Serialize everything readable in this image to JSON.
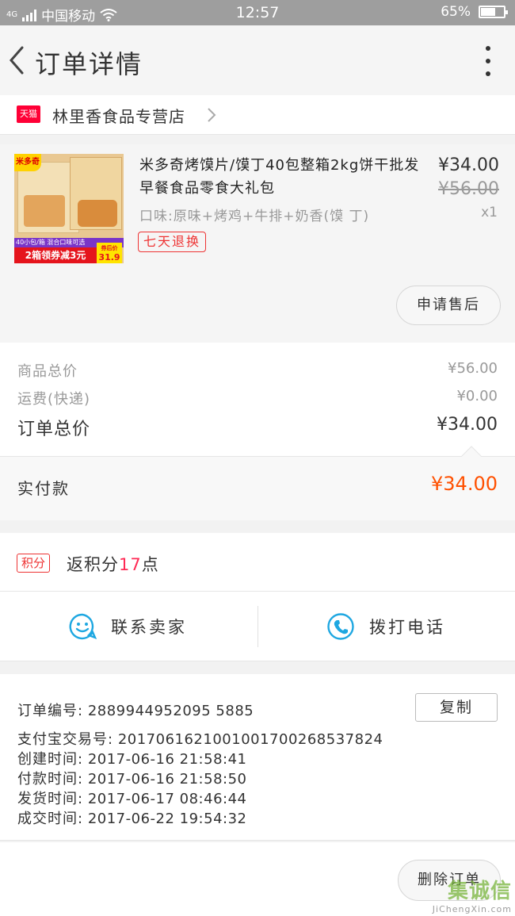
{
  "status": {
    "carrier": "中国移动",
    "network": "4G",
    "time": "12:57",
    "battery": "65%",
    "battery_level": 0.65
  },
  "nav": {
    "title": "订单详情",
    "back_icon": "chevron-left-icon",
    "more_icon": "more-vertical-icon"
  },
  "shop": {
    "badge": "天猫",
    "name": "林里香食品专营店"
  },
  "product": {
    "title": "米多奇烤馍片/馍丁40包整箱2kg饼干批发早餐食品零食大礼包",
    "spec": "口味:原味+烤鸡+牛排+奶香(馍 丁)",
    "price": "¥34.00",
    "original_price": "¥56.00",
    "qty": "x1",
    "tag": "七天退换",
    "image": {
      "brand_badge": "米多奇",
      "strip": "40小包/箱 混合口味可选",
      "promo": "2箱领券减3元",
      "price_label": "券后价",
      "price": "31.9"
    },
    "after_sale_label": "申请售后"
  },
  "summary": {
    "goods_total_label": "商品总价",
    "goods_total": "¥56.00",
    "shipping_label": "运费(快递)",
    "shipping": "¥0.00",
    "order_total_label": "订单总价",
    "order_total": "¥34.00",
    "paid_label": "实付款",
    "paid": "¥34.00"
  },
  "points": {
    "badge": "积分",
    "text_before": "返积分",
    "value": "17",
    "text_after": "点"
  },
  "contact": {
    "seller_label": "联系卖家",
    "call_label": "拨打电话"
  },
  "order_info": {
    "copy_label": "复制",
    "rows": [
      {
        "k": "订单编号:",
        "v": "2889944952095 5885"
      },
      {
        "k": "支付宝交易号:",
        "v": "2017061621001001700268537824"
      },
      {
        "k": "创建时间:",
        "v": "2017-06-16 21:58:41"
      },
      {
        "k": "付款时间:",
        "v": "2017-06-16 21:58:50"
      },
      {
        "k": "发货时间:",
        "v": "2017-06-17 08:46:44"
      },
      {
        "k": "成交时间:",
        "v": "2017-06-22 19:54:32"
      }
    ]
  },
  "footer": {
    "delete_label": "删除订单"
  },
  "watermark": {
    "big": "集诚信",
    "small": "JiChengXin.com"
  },
  "colors": {
    "accent_orange": "#ff5000",
    "tmall_red": "#ff0036",
    "points_pink": "#ff2a55",
    "icon_blue": "#1ea7e1"
  }
}
